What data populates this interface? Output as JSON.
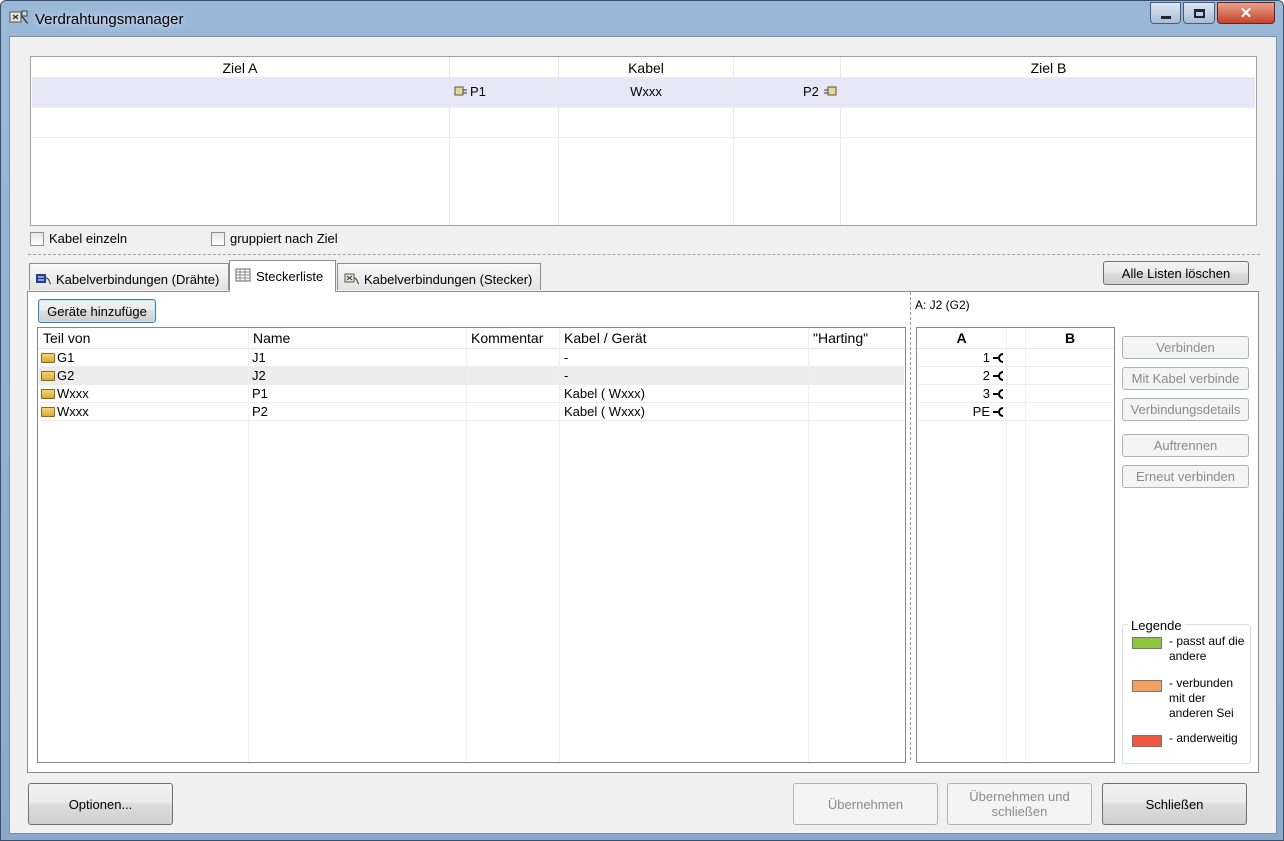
{
  "window": {
    "title": "Verdrahtungsmanager"
  },
  "top_grid": {
    "headers": {
      "ziel_a": "Ziel A",
      "kabel": "Kabel",
      "ziel_b": "Ziel B"
    },
    "row": {
      "left_pin": "P1",
      "cable": "Wxxx",
      "right_pin": "P2"
    }
  },
  "options": {
    "kabel_einzeln": "Kabel einzeln",
    "gruppiert": "gruppiert nach Ziel"
  },
  "tabs": [
    {
      "label": "Kabelverbindungen (Drähte)",
      "icon": "wire-icon"
    },
    {
      "label": "Steckerliste",
      "icon": "table-icon"
    },
    {
      "label": "Kabelverbindungen (Stecker)",
      "icon": "connector-icon"
    }
  ],
  "actions": {
    "clear_lists": "Alle Listen löschen",
    "add_devices": "Geräte hinzufüge"
  },
  "connector_list": {
    "headers": [
      "Teil von",
      "Name",
      "Kommentar",
      "Kabel / Gerät",
      "\"Harting\""
    ],
    "rows": [
      {
        "teil": "G1",
        "name": "J1",
        "kommentar": "",
        "kabel": "-"
      },
      {
        "teil": "G2",
        "name": "J2",
        "kommentar": "",
        "kabel": "-"
      },
      {
        "teil": "Wxxx",
        "name": "P1",
        "kommentar": "",
        "kabel": "Kabel ( Wxxx)"
      },
      {
        "teil": "Wxxx",
        "name": "P2",
        "kommentar": "",
        "kabel": "Kabel ( Wxxx)"
      }
    ]
  },
  "pin_panel": {
    "caption": "A: J2 (G2)",
    "headers": {
      "a": "A",
      "b": "B"
    },
    "pins": [
      "1",
      "2",
      "3",
      "PE"
    ]
  },
  "side_buttons": {
    "verbinden": "Verbinden",
    "mit_kabel": "Mit Kabel verbinde",
    "details": "Verbindungsdetails",
    "auftrennen": "Auftrennen",
    "erneut": "Erneut verbinden"
  },
  "legend": {
    "title": "Legende",
    "items": [
      {
        "text": "- passt auf die andere",
        "color": "#8dc63f"
      },
      {
        "text": "- verbunden mit der anderen Sei",
        "color": "#f4a15f"
      },
      {
        "text": "- anderweitig",
        "color": "#f0553f"
      }
    ]
  },
  "footer": {
    "optionen": "Optionen...",
    "uebernehmen": "Übernehmen",
    "uebernehmen_schliessen": "Übernehmen und schließen",
    "schliessen": "Schließen"
  }
}
